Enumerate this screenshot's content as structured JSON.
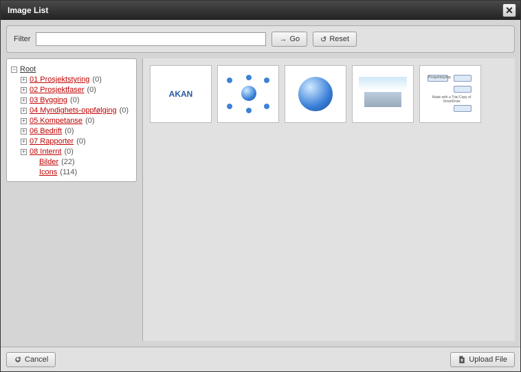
{
  "dialog": {
    "title": "Image List"
  },
  "filter": {
    "label": "Filter",
    "value": "",
    "go_label": "Go",
    "reset_label": "Reset"
  },
  "tree": {
    "root_label": "Root",
    "items": [
      {
        "label": "01 Prosjektstyring",
        "count": "(0)"
      },
      {
        "label": "02 Prosjektfaser",
        "count": "(0)"
      },
      {
        "label": "03 Bygging",
        "count": "(0)"
      },
      {
        "label": "04 Myndighets-oppfølging",
        "count": "(0)"
      },
      {
        "label": "05 Kompetanse",
        "count": "(0)"
      },
      {
        "label": "06 Bedrift",
        "count": "(0)"
      },
      {
        "label": "07 Rapporter",
        "count": "(0)"
      },
      {
        "label": "08 Internt",
        "count": "(0)"
      }
    ],
    "sub": [
      {
        "label": "Bilder",
        "count": "(22)"
      },
      {
        "label": "Icons",
        "count": "(114)"
      }
    ]
  },
  "thumbnails": [
    {
      "name": "akan-logo",
      "text": "AKAN"
    },
    {
      "name": "network-globe"
    },
    {
      "name": "globe"
    },
    {
      "name": "building"
    },
    {
      "name": "flowchart",
      "box_label": "Prosjektstyring",
      "caption": "Made with a Trial Copy of SmartDraw"
    }
  ],
  "footer": {
    "cancel_label": "Cancel",
    "upload_label": "Upload File"
  },
  "icons": {
    "close": "✕",
    "go_arrow": "→",
    "reset": "↺",
    "cancel": "↺",
    "minus": "−",
    "plus": "+"
  }
}
